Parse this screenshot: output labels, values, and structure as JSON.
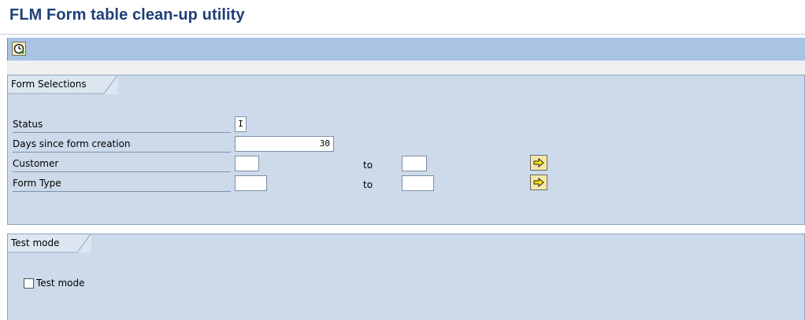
{
  "app": {
    "title": "FLM Form table clean-up utility"
  },
  "toolbar": {
    "execute_icon": "execute-clock-icon"
  },
  "form_selections": {
    "group_title": "Form Selections",
    "status": {
      "label": "Status",
      "value": "I"
    },
    "days": {
      "label": "Days since form creation",
      "value": "30"
    },
    "customer": {
      "label": "Customer",
      "from": "",
      "to_label": "to",
      "to": "",
      "multi_icon": "multiple-selection-arrow-icon"
    },
    "form_type": {
      "label": "Form Type",
      "from": "",
      "to_label": "to",
      "to": "",
      "multi_icon": "multiple-selection-arrow-icon"
    }
  },
  "test_mode": {
    "group_title": "Test mode",
    "checkbox_label": "Test mode",
    "checked": false
  },
  "colors": {
    "title": "#1f3f76",
    "toolbar": "#a8c3e4",
    "group_bg": "#ccdaea",
    "button": "#f4e7a8"
  }
}
